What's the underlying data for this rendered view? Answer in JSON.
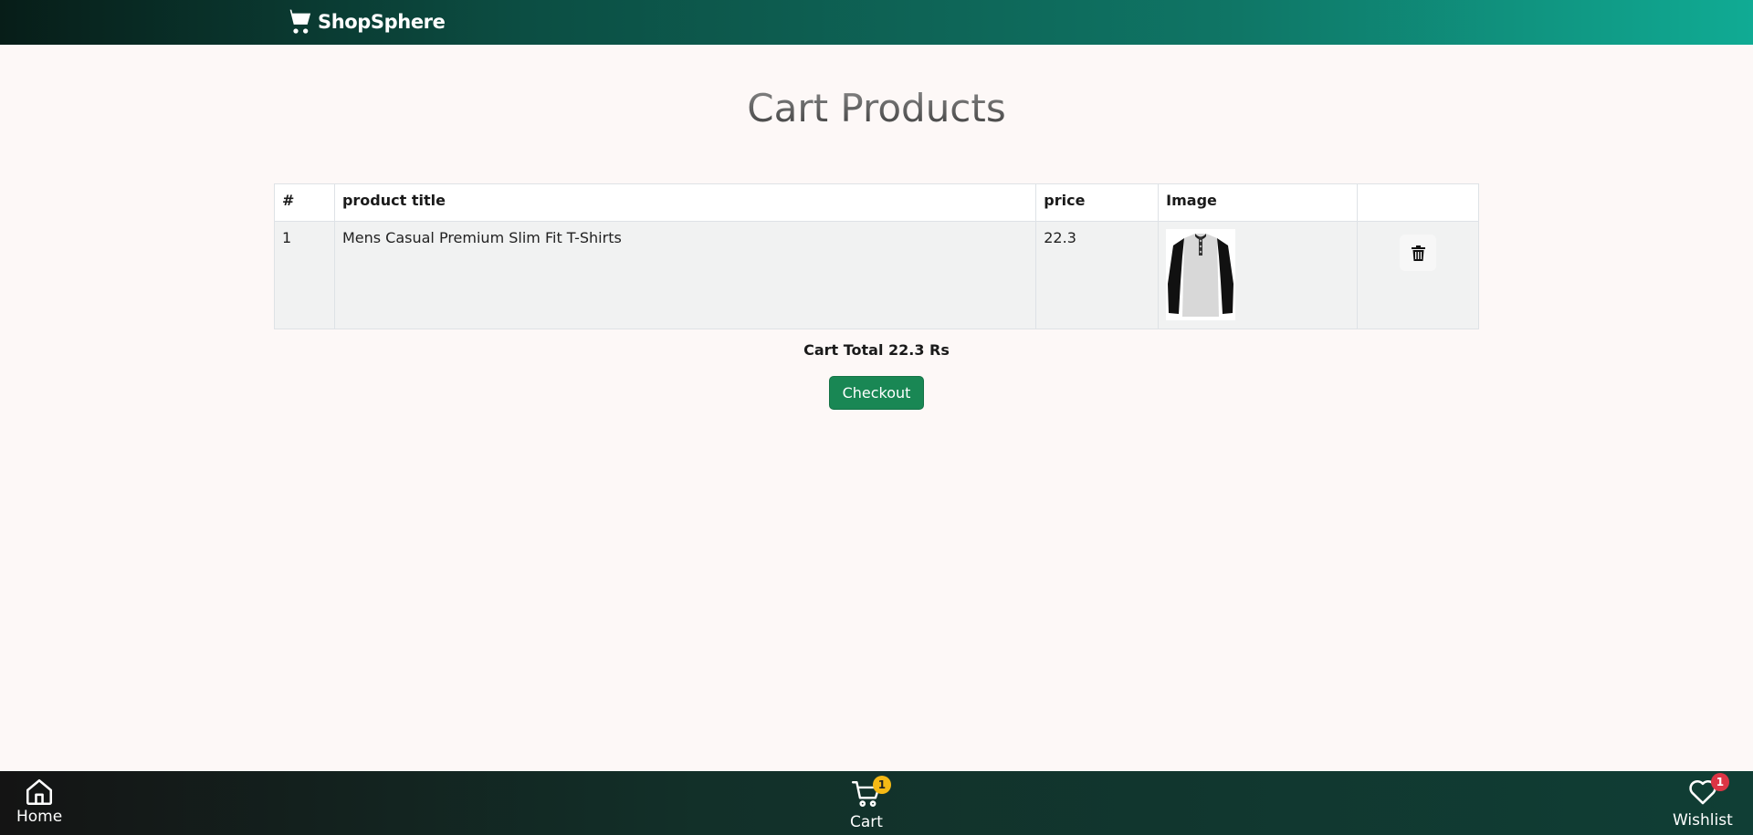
{
  "brand": {
    "name": "ShopSphere"
  },
  "page": {
    "title": "Cart Products"
  },
  "table": {
    "headers": [
      "#",
      "product title",
      "price",
      "Image",
      ""
    ],
    "rows": [
      {
        "index": "1",
        "title": "Mens Casual Premium Slim Fit T-Shirts",
        "price": "22.3",
        "image": "tshirt-image"
      }
    ]
  },
  "summary": {
    "total": "Cart Total 22.3 Rs",
    "checkout_label": "Checkout"
  },
  "bottom_nav": {
    "home": {
      "label": "Home",
      "icon": "home-icon"
    },
    "cart": {
      "label": "Cart",
      "icon": "cart-icon",
      "count": "1"
    },
    "wishlist": {
      "label": "Wishlist",
      "icon": "heart-icon",
      "count": "1"
    }
  },
  "colors": {
    "checkout": "#198754",
    "cart_badge": "#f5b915",
    "wishlist_badge": "#dc3545",
    "header_gradient_end": "#10ab94"
  }
}
